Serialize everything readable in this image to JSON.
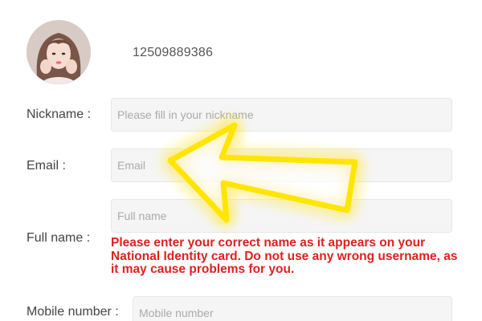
{
  "profile": {
    "phone": "12509889386",
    "avatar_icon": "user-portrait-icon"
  },
  "form": {
    "nickname": {
      "label": "Nickname :",
      "placeholder": "Please fill in your nickname",
      "value": ""
    },
    "email": {
      "label": "Email :",
      "placeholder": "Email",
      "value": ""
    },
    "full_name": {
      "label": "Full name :",
      "placeholder": "Full name",
      "value": "",
      "note": "Please enter your correct name as it appears on your National Identity card. Do not use any wrong username, as it may cause problems for you."
    },
    "mobile": {
      "label": "Mobile number :",
      "placeholder": "Mobile number",
      "value": ""
    }
  },
  "overlay": {
    "arrow_icon": "yellow-arrow-icon",
    "arrow_color": "#ffe500"
  },
  "colors": {
    "note_text": "#e02020",
    "label_text": "#444444",
    "field_bg": "#f5f5f5"
  }
}
